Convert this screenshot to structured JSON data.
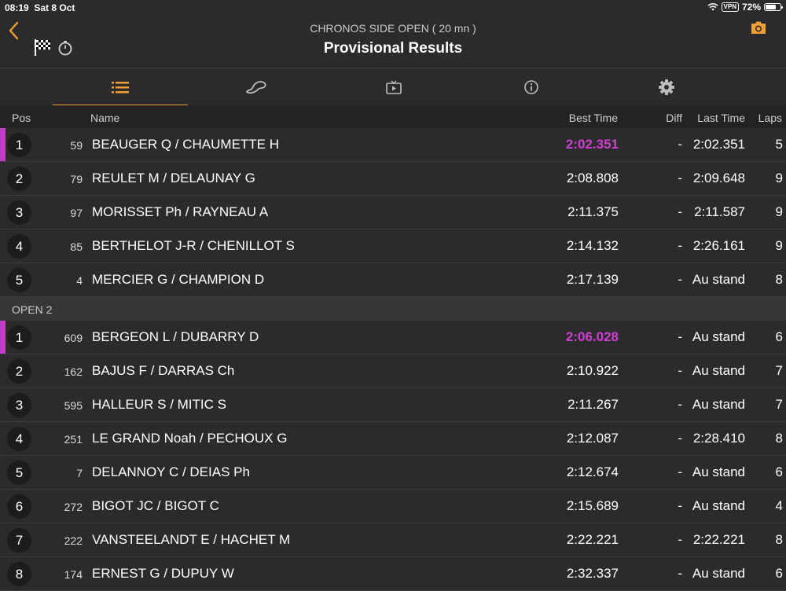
{
  "status": {
    "time": "08:19",
    "date": "Sat 8 Oct",
    "vpn": "VPN",
    "battery": "72%",
    "battery_fill": 0.72
  },
  "header": {
    "subtitle": "CHRONOS SIDE OPEN ( 20 mn )",
    "title": "Provisional Results"
  },
  "accent_color": "#f0a030",
  "best_lap_color": "#d13ed1",
  "tabs": [
    {
      "icon": "list-icon",
      "active": true
    },
    {
      "icon": "track-icon",
      "active": false
    },
    {
      "icon": "tv-icon",
      "active": false
    },
    {
      "icon": "info-icon",
      "active": false
    },
    {
      "icon": "gear-icon",
      "active": false
    }
  ],
  "columns": {
    "pos": "Pos",
    "name": "Name",
    "best": "Best Time",
    "diff": "Diff",
    "last": "Last Time",
    "laps": "Laps"
  },
  "groups": [
    {
      "label": "",
      "rows": [
        {
          "pos": "1",
          "num": "59",
          "name": "BEAUGER  Q / CHAUMETTE H",
          "best": "2:02.351",
          "diff": "-",
          "last": "2:02.351",
          "laps": "5",
          "highlight": true
        },
        {
          "pos": "2",
          "num": "79",
          "name": "REULET M / DELAUNAY G",
          "best": "2:08.808",
          "diff": "-",
          "last": "2:09.648",
          "laps": "9"
        },
        {
          "pos": "3",
          "num": "97",
          "name": "MORISSET Ph / RAYNEAU A",
          "best": "2:11.375",
          "diff": "-",
          "last": "2:11.587",
          "laps": "9"
        },
        {
          "pos": "4",
          "num": "85",
          "name": "BERTHELOT J-R / CHENILLOT S",
          "best": "2:14.132",
          "diff": "-",
          "last": "2:26.161",
          "laps": "9"
        },
        {
          "pos": "5",
          "num": "4",
          "name": "MERCIER G / CHAMPION D",
          "best": "2:17.139",
          "diff": "-",
          "last": "Au stand",
          "laps": "8"
        }
      ]
    },
    {
      "label": "OPEN 2",
      "rows": [
        {
          "pos": "1",
          "num": "609",
          "name": "BERGEON L / DUBARRY D",
          "best": "2:06.028",
          "diff": "-",
          "last": "Au stand",
          "laps": "6",
          "highlight": true
        },
        {
          "pos": "2",
          "num": "162",
          "name": "BAJUS F / DARRAS Ch",
          "best": "2:10.922",
          "diff": "-",
          "last": "Au stand",
          "laps": "7"
        },
        {
          "pos": "3",
          "num": "595",
          "name": "HALLEUR S / MITIC S",
          "best": "2:11.267",
          "diff": "-",
          "last": "Au stand",
          "laps": "7"
        },
        {
          "pos": "4",
          "num": "251",
          "name": "LE GRAND Noah / PECHOUX G",
          "best": "2:12.087",
          "diff": "-",
          "last": "2:28.410",
          "laps": "8"
        },
        {
          "pos": "5",
          "num": "7",
          "name": "DELANNOY C / DEIAS Ph",
          "best": "2:12.674",
          "diff": "-",
          "last": "Au stand",
          "laps": "6"
        },
        {
          "pos": "6",
          "num": "272",
          "name": "BIGOT JC / BIGOT C",
          "best": "2:15.689",
          "diff": "-",
          "last": "Au stand",
          "laps": "4"
        },
        {
          "pos": "7",
          "num": "222",
          "name": "VANSTEELANDT E / HACHET M",
          "best": "2:22.221",
          "diff": "-",
          "last": "2:22.221",
          "laps": "8"
        },
        {
          "pos": "8",
          "num": "174",
          "name": "ERNEST G / DUPUY W",
          "best": "2:32.337",
          "diff": "-",
          "last": "Au stand",
          "laps": "6"
        }
      ]
    }
  ]
}
